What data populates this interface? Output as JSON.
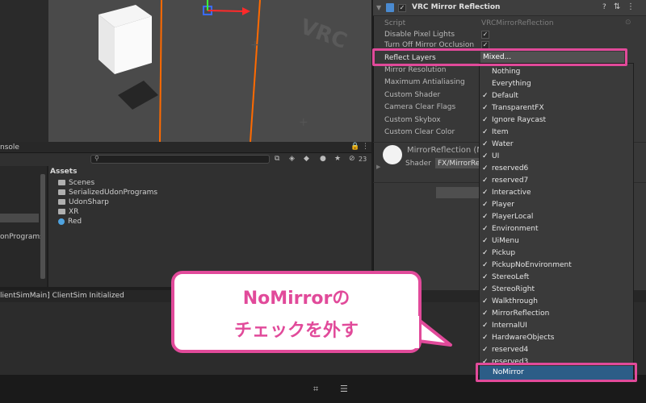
{
  "inspector": {
    "title": "VRC Mirror Reflection",
    "props": {
      "script_label": "Script",
      "script_value": "VRCMirrorReflection",
      "disable_pixel_lights": "Disable Pixel Lights",
      "turn_off_occlusion": "Turn Off Mirror Occlusion",
      "reflect_layers": "Reflect Layers",
      "reflect_value": "Mixed...",
      "mirror_resolution": "Mirror Resolution",
      "max_antialiasing": "Maximum Antialiasing",
      "custom_shader": "Custom Shader",
      "clear_flags": "Camera Clear Flags",
      "custom_skybox": "Custom Skybox",
      "custom_clear_color": "Custom Clear Color"
    },
    "material": {
      "name": "MirrorReflection (M",
      "shader_label": "Shader",
      "shader_value": "FX/MirrorRef"
    }
  },
  "console": {
    "tab_label": "nsole",
    "search_count": "23",
    "status_text": "lientSimMain] ClientSim Initialized"
  },
  "project": {
    "left_item": "onPrograms",
    "assets_header": "Assets",
    "assets": [
      "Scenes",
      "SerializedUdonPrograms",
      "UdonSharp",
      "XR",
      "Red"
    ]
  },
  "dropdown": {
    "items": [
      {
        "label": "Nothing",
        "checked": false
      },
      {
        "label": "Everything",
        "checked": false
      },
      {
        "label": "Default",
        "checked": true
      },
      {
        "label": "TransparentFX",
        "checked": true
      },
      {
        "label": "Ignore Raycast",
        "checked": true
      },
      {
        "label": "Item",
        "checked": true
      },
      {
        "label": "Water",
        "checked": true
      },
      {
        "label": "UI",
        "checked": true
      },
      {
        "label": "reserved6",
        "checked": true
      },
      {
        "label": "reserved7",
        "checked": true
      },
      {
        "label": "Interactive",
        "checked": true
      },
      {
        "label": "Player",
        "checked": true
      },
      {
        "label": "PlayerLocal",
        "checked": true
      },
      {
        "label": "Environment",
        "checked": true
      },
      {
        "label": "UiMenu",
        "checked": true
      },
      {
        "label": "Pickup",
        "checked": true
      },
      {
        "label": "PickupNoEnvironment",
        "checked": true
      },
      {
        "label": "StereoLeft",
        "checked": true
      },
      {
        "label": "StereoRight",
        "checked": true
      },
      {
        "label": "Walkthrough",
        "checked": true
      },
      {
        "label": "MirrorReflection",
        "checked": true
      },
      {
        "label": "InternalUI",
        "checked": true
      },
      {
        "label": "HardwareObjects",
        "checked": true
      },
      {
        "label": "reserved4",
        "checked": true
      },
      {
        "label": "reserved3",
        "checked": true
      }
    ],
    "selected_label": "NoMirror"
  },
  "callout": {
    "line1": "NoMirrorの",
    "line2": "チェックを外す"
  },
  "colors": {
    "highlight": "#e14a9a",
    "selection": "#2c5d87",
    "scene_outline": "#ff6a00"
  }
}
